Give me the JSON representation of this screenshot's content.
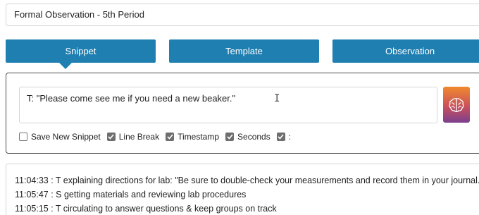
{
  "observation_title": "Formal Observation - 5th Period",
  "tabs": {
    "snippet": "Snippet",
    "template": "Template",
    "observation": "Observation"
  },
  "snippet": {
    "input_value": "T: \"Please come see me if you need a new beaker.\"",
    "brain_icon": "brain-icon"
  },
  "options": {
    "save_new_snippet": {
      "label": "Save New Snippet",
      "checked": false
    },
    "line_break": {
      "label": "Line Break",
      "checked": true
    },
    "timestamp": {
      "label": "Timestamp",
      "checked": true
    },
    "seconds": {
      "label": "Seconds",
      "checked": true
    },
    "separator": {
      "label": ":",
      "checked": true
    }
  },
  "log": [
    {
      "text": "11:04:33 : T explaining directions for lab: \"Be sure to double-check your measurements and record them in your journal.\""
    },
    {
      "text": "11:05:47 : S getting materials and reviewing lab procedures"
    },
    {
      "text": "11:05:15 : T circulating to answer questions & keep groups on track"
    }
  ],
  "colors": {
    "tab_blue": "#1f7fb1",
    "brain_gradient_top": "#f08a2c",
    "brain_gradient_bottom": "#7a3f8f"
  }
}
